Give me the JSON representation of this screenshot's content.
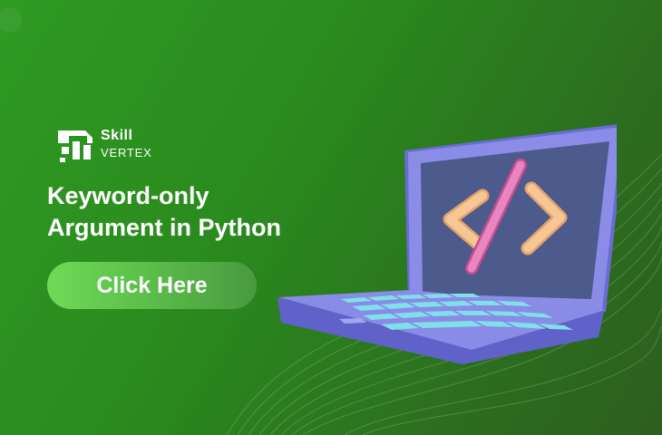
{
  "brand": {
    "name_line1": "Skill",
    "name_line2": "VERTEX",
    "logo_icon": "skill-vertex-logo-icon"
  },
  "headline": {
    "line1": "Keyword-only",
    "line2": "Argument in Python"
  },
  "cta": {
    "label": "Click Here"
  },
  "illustration": {
    "subject": "laptop-code-icon"
  },
  "colors": {
    "background": "#2a8a1e",
    "laptop_body": "#7b7ce0",
    "screen": "#4d5a8c",
    "keys": "#7fe0e8",
    "brackets": "#f3c08e",
    "slash": "#e27ab4",
    "cta_gradient_start": "#6fda57"
  }
}
